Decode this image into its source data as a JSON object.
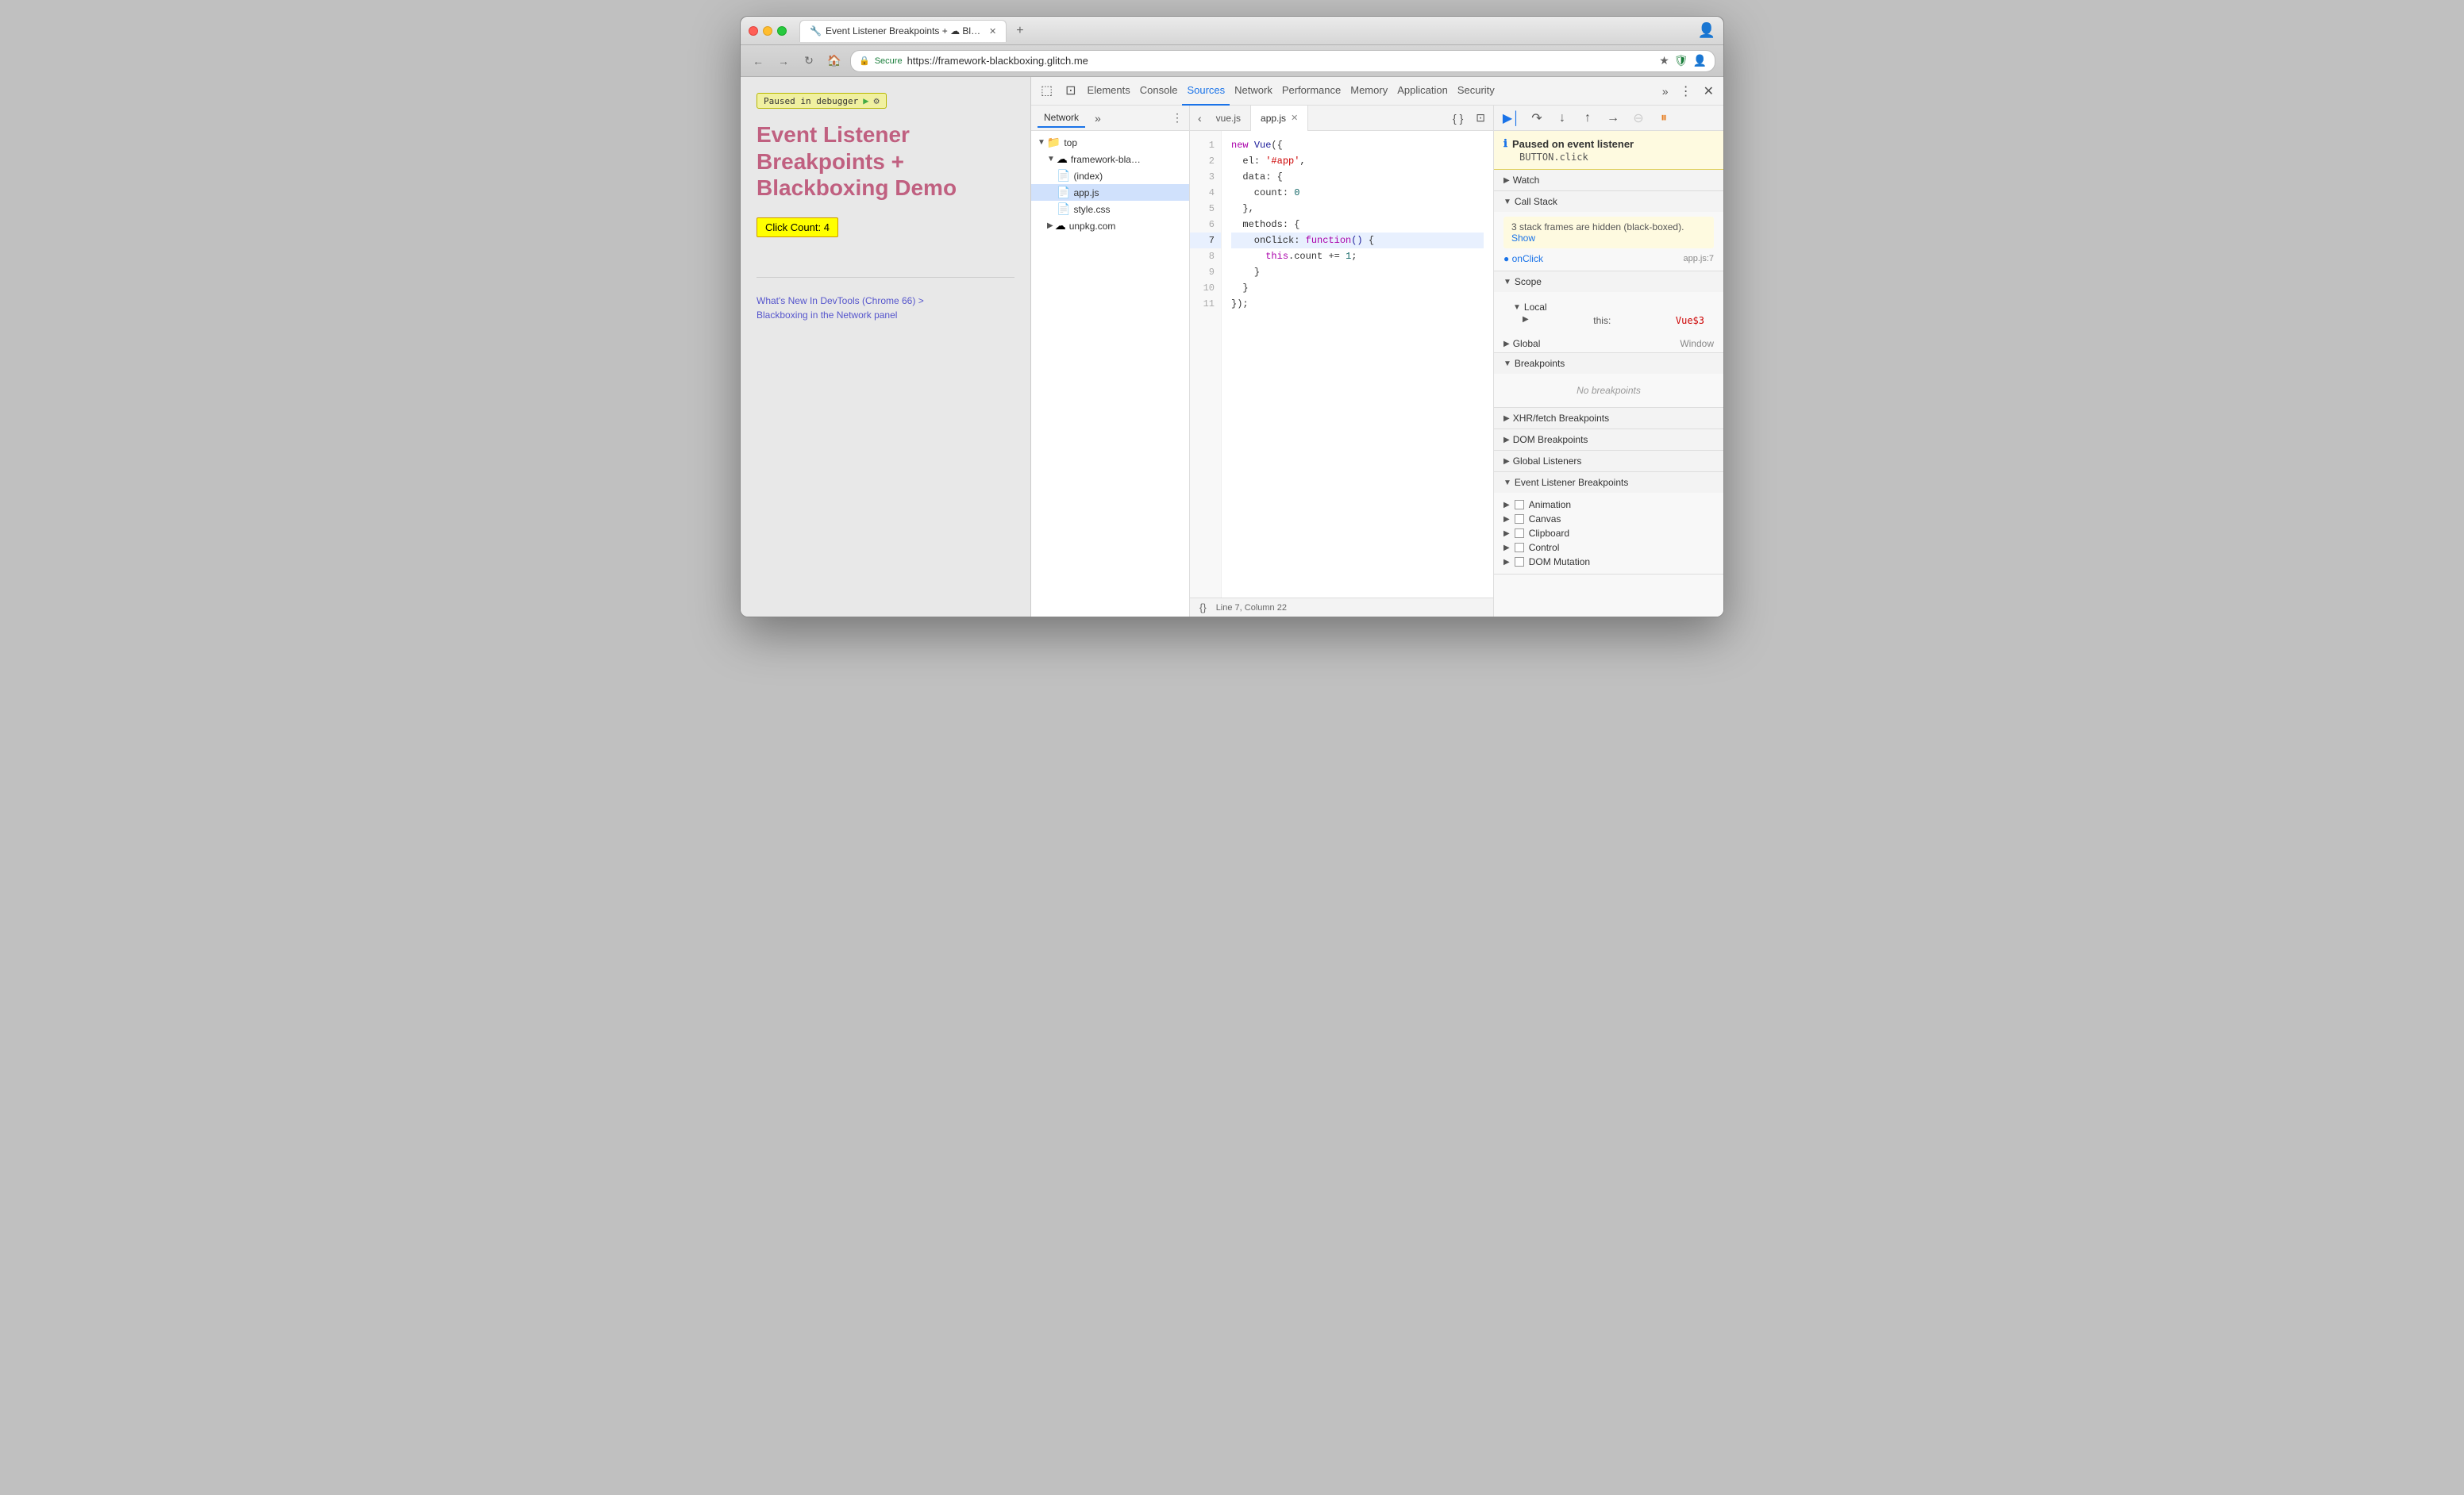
{
  "browser": {
    "title": "Event Listener Breakpoints + ☁ Blackboxing Demo",
    "url": "https://framework-blackboxing.glitch.me",
    "secure_label": "Secure"
  },
  "devtools": {
    "tabs": [
      {
        "label": "Elements",
        "active": false
      },
      {
        "label": "Console",
        "active": false
      },
      {
        "label": "Sources",
        "active": true
      },
      {
        "label": "Network",
        "active": false
      },
      {
        "label": "Performance",
        "active": false
      },
      {
        "label": "Memory",
        "active": false
      },
      {
        "label": "Application",
        "active": false
      },
      {
        "label": "Security",
        "active": false
      }
    ]
  },
  "file_tree": {
    "tab_label": "Network",
    "items": [
      {
        "label": "top",
        "type": "folder",
        "indent": 0,
        "expanded": true
      },
      {
        "label": "framework-bla…",
        "type": "cloud-folder",
        "indent": 1,
        "expanded": true
      },
      {
        "label": "(index)",
        "type": "file",
        "indent": 2
      },
      {
        "label": "app.js",
        "type": "file-yellow",
        "indent": 2
      },
      {
        "label": "style.css",
        "type": "file-purple",
        "indent": 2
      },
      {
        "label": "unpkg.com",
        "type": "cloud-folder",
        "indent": 1,
        "expanded": false
      }
    ]
  },
  "editor": {
    "tabs": [
      {
        "label": "vue.js",
        "active": false,
        "closeable": false
      },
      {
        "label": "app.js",
        "active": true,
        "closeable": true
      }
    ],
    "lines": [
      {
        "num": 1,
        "content": "new Vue({"
      },
      {
        "num": 2,
        "content": "  el: '#app',"
      },
      {
        "num": 3,
        "content": "  data: {"
      },
      {
        "num": 4,
        "content": "    count: 0"
      },
      {
        "num": 5,
        "content": "  },"
      },
      {
        "num": 6,
        "content": "  methods: {"
      },
      {
        "num": 7,
        "content": "    onClick: function() {",
        "highlighted": true
      },
      {
        "num": 8,
        "content": "      this.count += 1;"
      },
      {
        "num": 9,
        "content": "    }"
      },
      {
        "num": 10,
        "content": "  }"
      },
      {
        "num": 11,
        "content": "});"
      }
    ],
    "status": "Line 7, Column 22",
    "format_icon": "{}"
  },
  "debugger": {
    "paused_title": "Paused on event listener",
    "paused_sub": "BUTTON.click",
    "sections": {
      "watch_label": "Watch",
      "call_stack_label": "Call Stack",
      "call_stack_warning": "3 stack frames are hidden (black-boxed).",
      "call_stack_show": "Show",
      "call_stack_item": {
        "fn": "onClick",
        "loc": "app.js:7"
      },
      "scope_label": "Scope",
      "local_label": "Local",
      "local_this": "Vue$3",
      "global_label": "Global",
      "global_val": "Window",
      "breakpoints_label": "Breakpoints",
      "no_breakpoints": "No breakpoints",
      "xhr_label": "XHR/fetch Breakpoints",
      "dom_label": "DOM Breakpoints",
      "global_listeners_label": "Global Listeners",
      "event_listener_label": "Event Listener Breakpoints",
      "event_items": [
        {
          "label": "Animation",
          "expanded": false
        },
        {
          "label": "Canvas",
          "expanded": false
        },
        {
          "label": "Clipboard",
          "expanded": false
        },
        {
          "label": "Control",
          "expanded": false
        },
        {
          "label": "DOM Mutation",
          "expanded": false
        }
      ]
    }
  },
  "webpage": {
    "paused_badge": "Paused in debugger",
    "title": "Event Listener Breakpoints + Blackboxing Demo",
    "click_count_label": "Click Count: 4",
    "link1": "What's New In DevTools (Chrome 66) >",
    "link2": "Blackboxing in the Network panel"
  }
}
